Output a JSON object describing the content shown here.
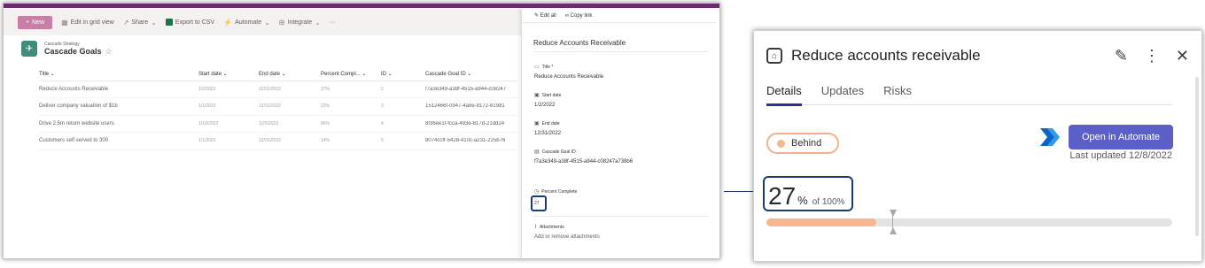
{
  "sharepoint": {
    "toolbar": {
      "new_label": "New",
      "grid_label": "Edit in grid view",
      "share_label": "Share",
      "export_label": "Export to CSV",
      "automate_label": "Automate",
      "integrate_label": "Integrate",
      "more_label": "···"
    },
    "list": {
      "site_name": "Cascade Strategy",
      "title": "Cascade Goals",
      "columns": [
        "Title",
        "Start date",
        "End date",
        "Percent Compl...",
        "ID",
        "Cascade Goal ID"
      ],
      "rows": [
        {
          "title": "Reduce Accounts Receivable",
          "start": "1/2/2022",
          "end": "12/31/2022",
          "pct": "27%",
          "id": "2",
          "goal_id": "f7a3e349-a38f-4515-a944-c08247"
        },
        {
          "title": "Deliver company valuation of $1b",
          "start": "1/1/2022",
          "end": "12/31/2022",
          "pct": "22%",
          "id": "3",
          "goal_id": "1512466f-0947-4a9e-8172-81981"
        },
        {
          "title": "Drive 2.5m return website users",
          "start": "1/19/2022",
          "end": "1/25/2023",
          "pct": "86%",
          "id": "4",
          "goal_id": "8f36ee1f-fcca-493e-817d-21dd24"
        },
        {
          "title": "Customers self served to 300",
          "start": "1/1/2022",
          "end": "12/31/2022",
          "pct": "14%",
          "id": "5",
          "goal_id": "8074ccff-5428-410c-a231-225b76"
        }
      ]
    },
    "pane": {
      "edit_all": "Edit all",
      "copy_link": "Copy link",
      "item_title": "Reduce Accounts Receivable",
      "fields": {
        "title_label": "Title *",
        "title_value": "Reduce Accounts Receivable",
        "start_label": "Start date",
        "start_value": "1/2/2022",
        "end_label": "End date",
        "end_value": "12/31/2022",
        "goal_id_label": "Cascade Goal ID",
        "goal_id_value": "f7a3e349-a38f-4515-a944-c08247a738b6",
        "pct_label": "Percent Complete",
        "pct_value": "27",
        "attach_label": "Attachments",
        "attach_hint": "Add or remove attachments"
      }
    }
  },
  "card": {
    "title": "Reduce accounts receivable",
    "tabs": [
      "Details",
      "Updates",
      "Risks"
    ],
    "status": "Behind",
    "open_button": "Open in Automate",
    "last_updated": "Last updated 12/8/2022",
    "percent": "27",
    "percent_symbol": "%",
    "of_total": "of 100%",
    "progress_fraction": 0.27
  },
  "colors": {
    "accent": "#6b2c6e",
    "new_button": "#c87ea6",
    "primary_button": "#5b5fc7",
    "progress_fill": "#f6b78f",
    "highlight_box": "#1f3b6e"
  }
}
